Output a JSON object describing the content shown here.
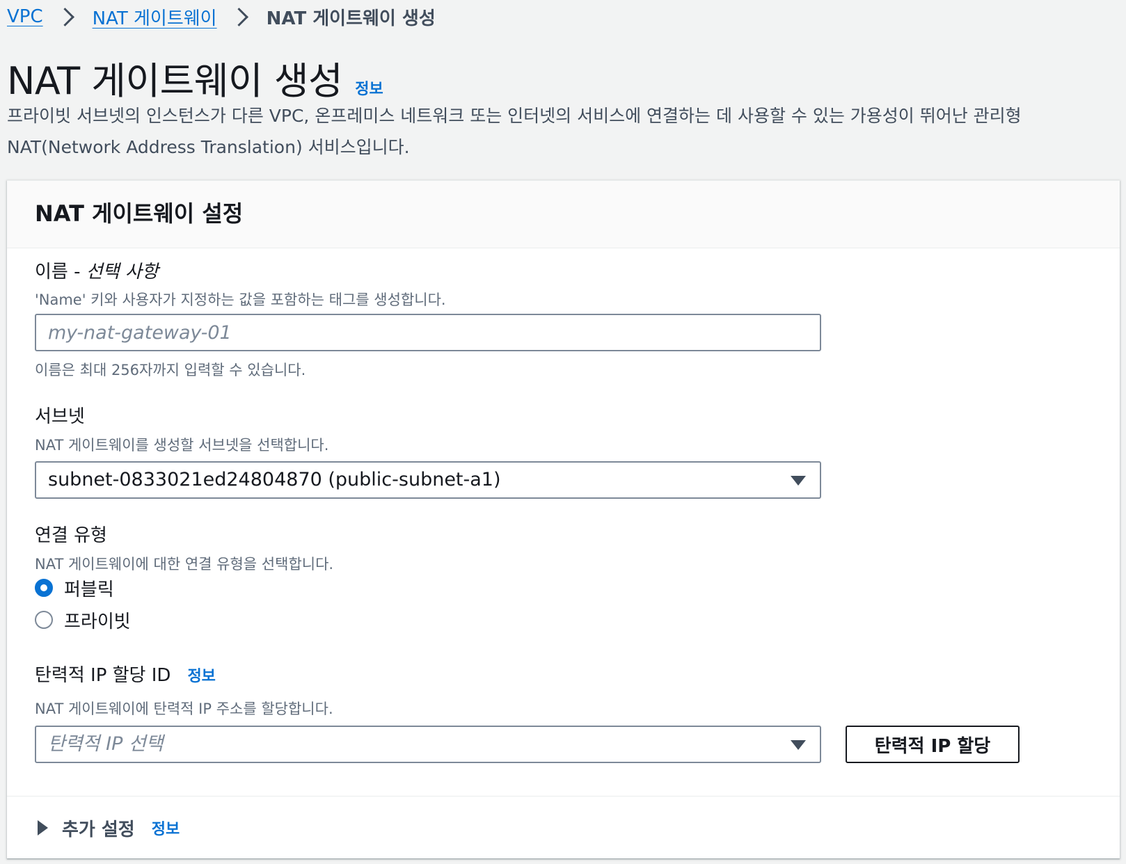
{
  "breadcrumb": {
    "items": [
      "VPC",
      "NAT 게이트웨이"
    ],
    "current": "NAT 게이트웨이 생성"
  },
  "header": {
    "title": "NAT 게이트웨이 생성",
    "info": "정보",
    "description": "프라이빗 서브넷의 인스턴스가 다른 VPC, 온프레미스 네트워크 또는 인터넷의 서비스에 연결하는 데 사용할 수 있는 가용성이 뛰어난 관리형 NAT(Network Address Translation) 서비스입니다."
  },
  "panel": {
    "title": "NAT 게이트웨이 설정",
    "name_field": {
      "label": "이름 - ",
      "label_optional": "선택 사항",
      "description": "'Name' 키와 사용자가 지정하는 값을 포함하는 태그를 생성합니다.",
      "placeholder": "my-nat-gateway-01",
      "value": "",
      "constraint": "이름은 최대 256자까지 입력할 수 있습니다."
    },
    "subnet_field": {
      "label": "서브넷",
      "description": "NAT 게이트웨이를 생성할 서브넷을 선택합니다.",
      "value": "subnet-0833021ed24804870 (public-subnet-a1)"
    },
    "connectivity_field": {
      "label": "연결 유형",
      "description": "NAT 게이트웨이에 대한 연결 유형을 선택합니다.",
      "options": [
        {
          "label": "퍼블릭",
          "checked": true
        },
        {
          "label": "프라이빗",
          "checked": false
        }
      ]
    },
    "eip_field": {
      "label": "탄력적 IP 할당 ID",
      "info": "정보",
      "description": "NAT 게이트웨이에 탄력적 IP 주소를 할당합니다.",
      "placeholder": "탄력적 IP 선택",
      "button": "탄력적 IP 할당"
    },
    "additional": {
      "label": "추가 설정",
      "info": "정보"
    }
  },
  "colors": {
    "link": "#0972d3",
    "text": "#16191f",
    "secondary_text": "#5f6b7a",
    "page_bg": "#f2f3f3",
    "border": "#7d8998"
  }
}
